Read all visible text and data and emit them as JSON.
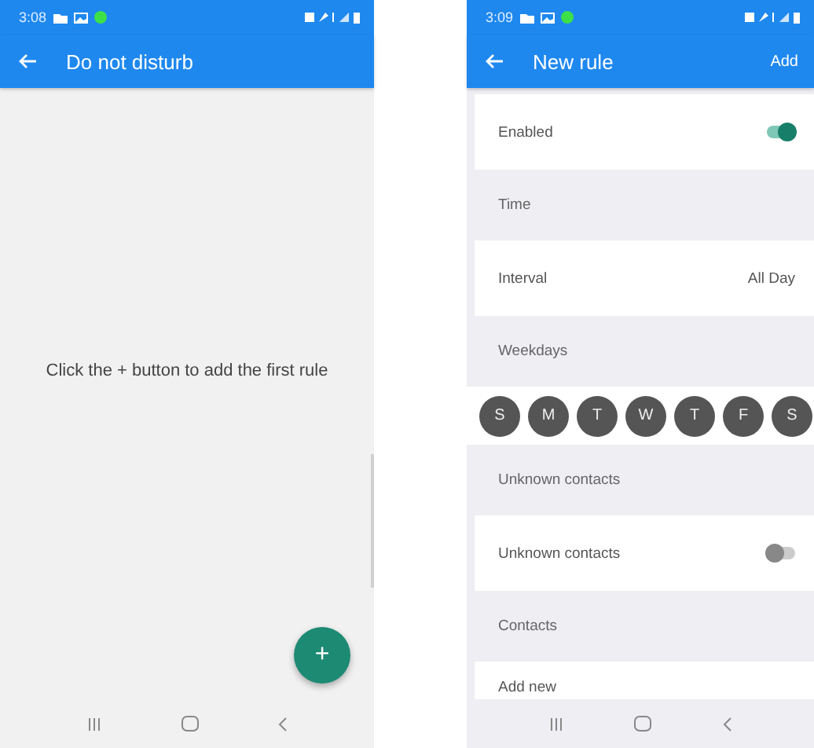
{
  "screens": [
    {
      "status_bar": {
        "time": "3:08"
      },
      "app_bar": {
        "title": "Do not disturb"
      },
      "empty_message": "Click the + button to add the first rule",
      "fab": {
        "label": "+"
      }
    },
    {
      "status_bar": {
        "time": "3:09"
      },
      "app_bar": {
        "title": "New rule",
        "action": "Add"
      },
      "items": [
        {
          "kind": "switch",
          "label": "Enabled",
          "on": true
        },
        {
          "kind": "header",
          "label": "Time"
        },
        {
          "kind": "value",
          "label": "Interval",
          "value": "All Day"
        },
        {
          "kind": "header",
          "label": "Weekdays"
        },
        {
          "kind": "days",
          "days": [
            {
              "label": "S",
              "selected": false
            },
            {
              "label": "M",
              "selected": false
            },
            {
              "label": "T",
              "selected": false
            },
            {
              "label": "W",
              "selected": false
            },
            {
              "label": "T",
              "selected": false
            },
            {
              "label": "F",
              "selected": false
            },
            {
              "label": "S",
              "selected": false
            }
          ]
        },
        {
          "kind": "header",
          "label": "Unknown contacts"
        },
        {
          "kind": "switch",
          "label": "Unknown contacts",
          "on": false
        },
        {
          "kind": "header",
          "label": "Contacts"
        },
        {
          "kind": "link",
          "label": "Add new"
        }
      ]
    }
  ]
}
